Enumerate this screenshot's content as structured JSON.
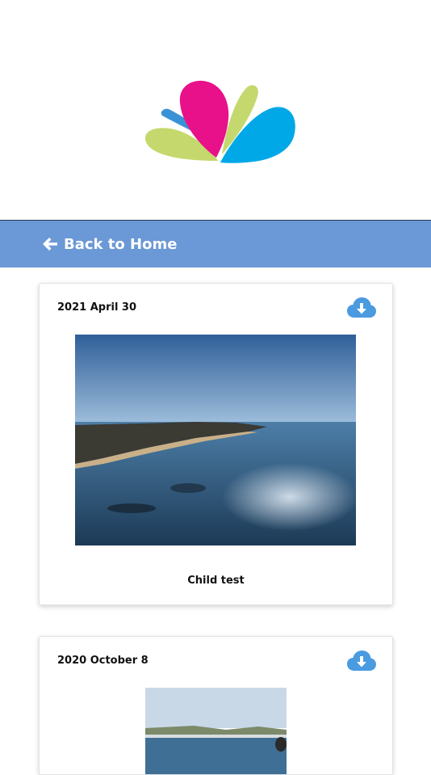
{
  "header": {
    "logo_icon": "petal-logo-icon",
    "colors": {
      "pink": "#e8118a",
      "green": "#c5d86d",
      "blue": "#00a8e8",
      "blue_dark": "#3a92d6"
    }
  },
  "nav": {
    "back_label": "Back to Home",
    "back_icon": "arrow-left-icon",
    "background": "#6b98d6"
  },
  "posts": [
    {
      "date": "2021 April 30",
      "download_icon": "cloud-download-icon",
      "caption": "Child test"
    },
    {
      "date": "2020 October 8",
      "download_icon": "cloud-download-icon"
    }
  ]
}
